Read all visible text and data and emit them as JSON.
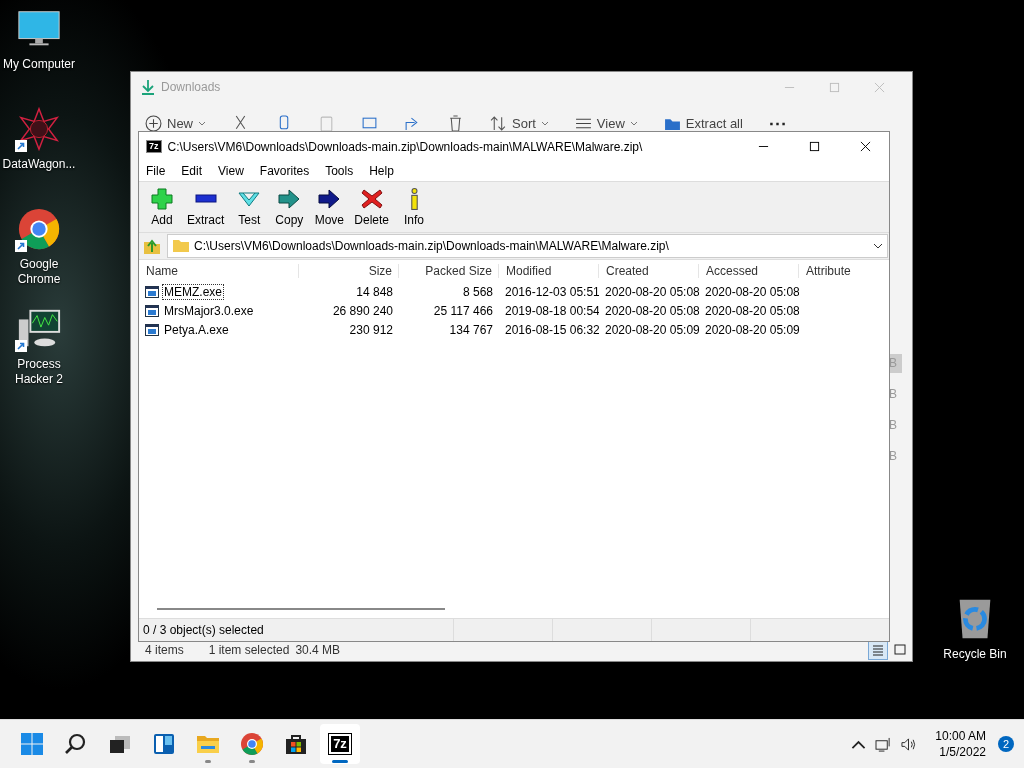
{
  "desktop_icons": [
    {
      "kind": "computer",
      "label": "My Computer",
      "shortcut": false
    },
    {
      "kind": "star",
      "label": "DataWagon...",
      "shortcut": true
    },
    {
      "kind": "chrome",
      "label": "Google Chrome",
      "shortcut": true
    },
    {
      "kind": "monitor",
      "label": "Process Hacker 2",
      "shortcut": true
    }
  ],
  "recycle_bin": {
    "label": "Recycle Bin"
  },
  "explorer": {
    "title": "Downloads",
    "toolbar": [
      {
        "kind": "new",
        "label": "New"
      },
      {
        "kind": "cut"
      },
      {
        "kind": "copy"
      },
      {
        "kind": "paste"
      },
      {
        "kind": "rename"
      },
      {
        "kind": "share"
      },
      {
        "kind": "delete"
      },
      {
        "kind": "sort",
        "label": "Sort"
      },
      {
        "kind": "view",
        "label": "View"
      },
      {
        "kind": "extract",
        "label": "Extract all"
      },
      {
        "kind": "more"
      }
    ],
    "partial_column": [
      {
        "text": "B",
        "selected": true
      },
      {
        "text": "B",
        "selected": false
      },
      {
        "text": "B",
        "selected": false
      },
      {
        "text": "B",
        "selected": false
      }
    ],
    "status": {
      "items": "4 items",
      "selection": "1 item selected",
      "size": "30.4 MB"
    },
    "view_buttons": [
      {
        "kind": "details",
        "selected": true
      },
      {
        "kind": "tiles",
        "selected": false
      }
    ]
  },
  "sevenzip": {
    "app_icon": "7z",
    "title": "C:\\Users\\VM6\\Downloads\\Downloads-main.zip\\Downloads-main\\MALWARE\\Malware.zip\\",
    "menu": [
      "File",
      "Edit",
      "View",
      "Favorites",
      "Tools",
      "Help"
    ],
    "toolbar": [
      {
        "kind": "add",
        "label": "Add"
      },
      {
        "kind": "extract",
        "label": "Extract"
      },
      {
        "kind": "test",
        "label": "Test"
      },
      {
        "kind": "copy",
        "label": "Copy"
      },
      {
        "kind": "move",
        "label": "Move"
      },
      {
        "kind": "delete",
        "label": "Delete"
      },
      {
        "kind": "info",
        "label": "Info"
      }
    ],
    "address": "C:\\Users\\VM6\\Downloads\\Downloads-main.zip\\Downloads-main\\MALWARE\\Malware.zip\\",
    "columns": [
      {
        "label": "Name",
        "numeric": false
      },
      {
        "label": "Size",
        "numeric": true
      },
      {
        "label": "Packed Size",
        "numeric": true
      },
      {
        "label": "Modified",
        "numeric": false
      },
      {
        "label": "Created",
        "numeric": false
      },
      {
        "label": "Accessed",
        "numeric": false
      },
      {
        "label": "Attribute",
        "numeric": false
      }
    ],
    "rows": [
      {
        "cells": [
          "MEMZ.exe",
          "14 848",
          "8 568",
          "2016-12-03 05:51",
          "2020-08-20 05:08",
          "2020-08-20 05:08"
        ],
        "focused": true
      },
      {
        "cells": [
          "MrsMajor3.0.exe",
          "26 890 240",
          "25 117 466",
          "2019-08-18 00:54",
          "2020-08-20 05:08",
          "2020-08-20 05:08"
        ],
        "focused": false
      },
      {
        "cells": [
          "Petya.A.exe",
          "230 912",
          "134 767",
          "2016-08-15 06:32",
          "2020-08-20 05:09",
          "2020-08-20 05:09"
        ],
        "focused": false
      }
    ],
    "status": "0 / 3 object(s) selected"
  },
  "taskbar": {
    "apps": [
      {
        "kind": "start",
        "running": false,
        "selected": false
      },
      {
        "kind": "search",
        "running": false,
        "selected": false
      },
      {
        "kind": "taskview",
        "running": false,
        "selected": false
      },
      {
        "kind": "widgets",
        "running": false,
        "selected": false
      },
      {
        "kind": "explorer",
        "running": true,
        "selected": false
      },
      {
        "kind": "chrome",
        "running": true,
        "selected": false
      },
      {
        "kind": "store",
        "running": false,
        "selected": false
      },
      {
        "kind": "sevenzip",
        "label": "7z",
        "running": true,
        "selected": true
      }
    ],
    "time": "10:00 AM",
    "date": "1/5/2022",
    "notifications": "2"
  }
}
